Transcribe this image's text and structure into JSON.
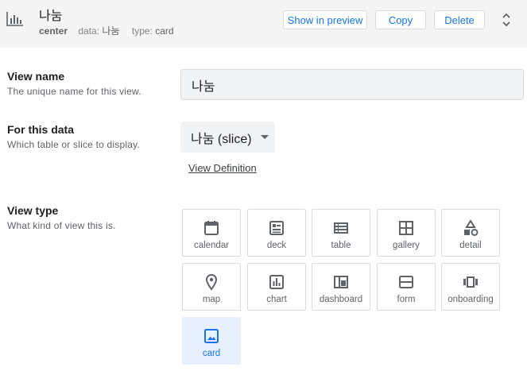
{
  "header": {
    "icon": "bar-chart-icon",
    "title": "나눔",
    "center_label": "center",
    "data_key": "data:",
    "data_value": "나눔",
    "type_key": "type:",
    "type_value": "card",
    "show_preview_label": "Show in preview",
    "copy_label": "Copy",
    "delete_label": "Delete"
  },
  "view_name": {
    "label": "View name",
    "description": "The unique name for this view.",
    "value": "나눔"
  },
  "for_this_data": {
    "label": "For this data",
    "description": "Which table or slice to display.",
    "selected": "나눔 (slice)",
    "link": "View Definition"
  },
  "view_type": {
    "label": "View type",
    "description": "What kind of view this is.",
    "options": [
      {
        "label": "calendar",
        "icon": "calendar-icon"
      },
      {
        "label": "deck",
        "icon": "deck-icon"
      },
      {
        "label": "table",
        "icon": "table-icon"
      },
      {
        "label": "gallery",
        "icon": "gallery-icon"
      },
      {
        "label": "detail",
        "icon": "detail-icon"
      },
      {
        "label": "map",
        "icon": "map-pin-icon"
      },
      {
        "label": "chart",
        "icon": "chart-icon"
      },
      {
        "label": "dashboard",
        "icon": "dashboard-icon"
      },
      {
        "label": "form",
        "icon": "form-icon"
      },
      {
        "label": "onboarding",
        "icon": "onboarding-icon"
      },
      {
        "label": "card",
        "icon": "card-image-icon"
      }
    ],
    "selected": "card"
  },
  "colors": {
    "accent": "#1a73e8",
    "selected_bg": "#e8f0fe",
    "icon_gray": "#5f6368"
  }
}
